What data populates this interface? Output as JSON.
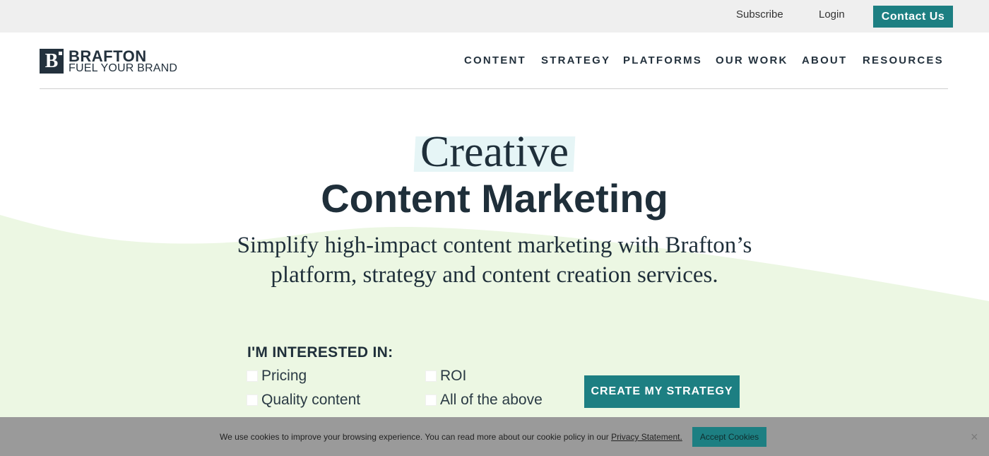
{
  "utility": {
    "subscribe": "Subscribe",
    "login": "Login",
    "contact": "Contact Us"
  },
  "brand": {
    "mark": "B",
    "name": "BRAFTON",
    "tagline": "FUEL YOUR BRAND"
  },
  "nav": {
    "items": [
      "CONTENT",
      "STRATEGY",
      "PLATFORMS",
      "OUR WORK",
      "ABOUT",
      "RESOURCES"
    ]
  },
  "hero": {
    "kicker": "Creative",
    "title": "Content Marketing",
    "subtitle_line1": "Simplify high-impact content marketing with Brafton’s",
    "subtitle_line2": "platform, strategy and content creation services."
  },
  "form": {
    "label": "I'M INTERESTED IN:",
    "options": [
      "Pricing",
      "ROI",
      "Quality content",
      "All of the above"
    ],
    "cta": "CREATE MY STRATEGY"
  },
  "cookie": {
    "text": "We use cookies to improve your browsing experience. You can read more about our cookie policy in our ",
    "link": "Privacy Statement.",
    "accept": "Accept Cookies",
    "close": "×"
  },
  "colors": {
    "accent": "#1d7f82",
    "text": "#1f2f3a",
    "wave": "#ecf7e3",
    "highlight": "#e6f5f6",
    "cookie_bar": "#9a9a9a"
  }
}
